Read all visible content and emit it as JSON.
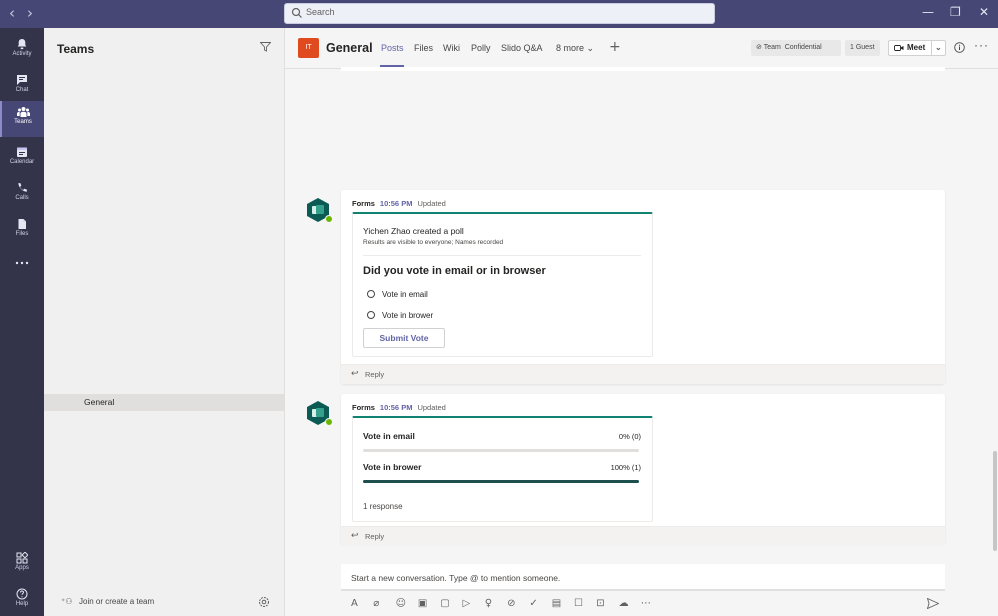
{
  "titlebar": {
    "search_placeholder": "Search",
    "back_arrow": "‹",
    "forward_arrow": "›",
    "min": "—",
    "restore": "❐",
    "close": "✕"
  },
  "rail": [
    {
      "label": "Activity",
      "icon": "bell-icon"
    },
    {
      "label": "Chat",
      "icon": "chat-icon"
    },
    {
      "label": "Teams",
      "icon": "teams-icon",
      "active": true
    },
    {
      "label": "Calendar",
      "icon": "calendar-icon"
    },
    {
      "label": "Calls",
      "icon": "phone-icon"
    },
    {
      "label": "Files",
      "icon": "file-icon"
    },
    {
      "label": "",
      "icon": "more-icon"
    },
    {
      "label": "Apps",
      "icon": "apps-icon"
    },
    {
      "label": "Help",
      "icon": "help-icon"
    }
  ],
  "teams_panel": {
    "title": "Teams",
    "channel": "General",
    "join": "Join or create a team"
  },
  "channel": {
    "avatar_text": "IT",
    "name": "General",
    "tabs": [
      "Posts",
      "Files",
      "Wiki",
      "Polly",
      "Slido Q&A",
      "8 more ⌄"
    ],
    "add_tab": "+",
    "pill_team": "Team",
    "pill_conf": "Confidential",
    "pill_guest": "1 Guest",
    "meet": "Meet",
    "meet_chevron": "⌄",
    "more": "···"
  },
  "posts": [
    {
      "sender": "Forms",
      "time": "10:56 PM",
      "status": "Updated",
      "poll": {
        "creator": "Yichen Zhao created a poll",
        "subtitle": "Results are visible to everyone; Names recorded",
        "question": "Did you vote in email or in browser",
        "options": [
          "Vote in email",
          "Vote in brower"
        ],
        "submit": "Submit Vote"
      },
      "reply": "Reply"
    },
    {
      "sender": "Forms",
      "time": "10:56 PM",
      "status": "Updated",
      "results": [
        {
          "label": "Vote in email",
          "value": "0% (0)",
          "fraction": 0
        },
        {
          "label": "Vote in brower",
          "value": "100% (1)",
          "fraction": 1
        }
      ],
      "responses": "1 response",
      "reply": "Reply"
    }
  ],
  "compose": {
    "placeholder": "Start a new conversation. Type @ to mention someone.",
    "tools": [
      "format-icon",
      "attach-icon",
      "emoji-icon",
      "gif-icon",
      "sticker-icon",
      "meet-now-icon",
      "praise-icon",
      "approvals-icon",
      "forms-icon",
      "stream-icon",
      "updates-icon",
      "share-screen-icon",
      "upload-icon",
      "more-options-icon"
    ]
  },
  "colors": {
    "titlebar": "#464775",
    "rail": "#33344a",
    "accent": "#6264a7",
    "forms_green": "#108272",
    "result_fill": "#1c4f4d",
    "online": "#6bb700",
    "channel_avatar": "#e04a1f"
  }
}
